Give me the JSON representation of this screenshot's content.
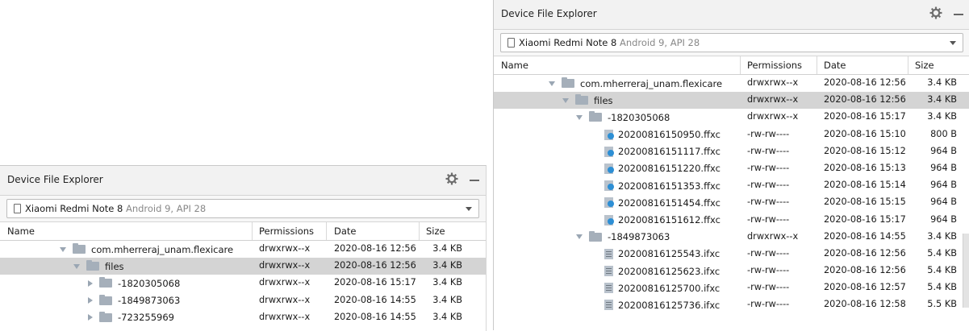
{
  "panel_a": {
    "title": "Device File Explorer",
    "device_name": "Xiaomi Redmi Note 8",
    "device_meta": "Android 9, API 28",
    "columns": {
      "name": "Name",
      "permissions": "Permissions",
      "date": "Date",
      "size": "Size"
    },
    "rows": [
      {
        "name": "com.mherreraj_unam.flexicare",
        "perm": "drwxrwx--x",
        "date": "2020-08-16 12:56",
        "size": "3.4 KB",
        "kind": "folder",
        "expanded": true,
        "depth": 0,
        "selected": false
      },
      {
        "name": "files",
        "perm": "drwxrwx--x",
        "date": "2020-08-16 12:56",
        "size": "3.4 KB",
        "kind": "folder",
        "expanded": true,
        "depth": 1,
        "selected": true
      },
      {
        "name": "-1820305068",
        "perm": "drwxrwx--x",
        "date": "2020-08-16 15:17",
        "size": "3.4 KB",
        "kind": "folder",
        "expanded": false,
        "depth": 2,
        "selected": false
      },
      {
        "name": "-1849873063",
        "perm": "drwxrwx--x",
        "date": "2020-08-16 14:55",
        "size": "3.4 KB",
        "kind": "folder",
        "expanded": false,
        "depth": 2,
        "selected": false
      },
      {
        "name": "-723255969",
        "perm": "drwxrwx--x",
        "date": "2020-08-16 14:55",
        "size": "3.4 KB",
        "kind": "folder",
        "expanded": false,
        "depth": 2,
        "selected": false
      }
    ]
  },
  "panel_b": {
    "title": "Device File Explorer",
    "device_name": "Xiaomi Redmi Note 8",
    "device_meta": "Android 9, API 28",
    "columns": {
      "name": "Name",
      "permissions": "Permissions",
      "date": "Date",
      "size": "Size"
    },
    "rows": [
      {
        "name": "com.mherreraj_unam.flexicare",
        "perm": "drwxrwx--x",
        "date": "2020-08-16 12:56",
        "size": "3.4 KB",
        "kind": "folder",
        "expanded": true,
        "depth": 0,
        "selected": false
      },
      {
        "name": "files",
        "perm": "drwxrwx--x",
        "date": "2020-08-16 12:56",
        "size": "3.4 KB",
        "kind": "folder",
        "expanded": true,
        "depth": 1,
        "selected": true
      },
      {
        "name": "-1820305068",
        "perm": "drwxrwx--x",
        "date": "2020-08-16 15:17",
        "size": "3.4 KB",
        "kind": "folder",
        "expanded": true,
        "depth": 2,
        "selected": false
      },
      {
        "name": "20200816150950.ffxc",
        "perm": "-rw-rw----",
        "date": "2020-08-16 15:10",
        "size": "800 B",
        "kind": "file-user",
        "depth": 3,
        "selected": false
      },
      {
        "name": "20200816151117.ffxc",
        "perm": "-rw-rw----",
        "date": "2020-08-16 15:12",
        "size": "964 B",
        "kind": "file-user",
        "depth": 3,
        "selected": false
      },
      {
        "name": "20200816151220.ffxc",
        "perm": "-rw-rw----",
        "date": "2020-08-16 15:13",
        "size": "964 B",
        "kind": "file-user",
        "depth": 3,
        "selected": false
      },
      {
        "name": "20200816151353.ffxc",
        "perm": "-rw-rw----",
        "date": "2020-08-16 15:14",
        "size": "964 B",
        "kind": "file-user",
        "depth": 3,
        "selected": false
      },
      {
        "name": "20200816151454.ffxc",
        "perm": "-rw-rw----",
        "date": "2020-08-16 15:15",
        "size": "964 B",
        "kind": "file-user",
        "depth": 3,
        "selected": false
      },
      {
        "name": "20200816151612.ffxc",
        "perm": "-rw-rw----",
        "date": "2020-08-16 15:17",
        "size": "964 B",
        "kind": "file-user",
        "depth": 3,
        "selected": false
      },
      {
        "name": "-1849873063",
        "perm": "drwxrwx--x",
        "date": "2020-08-16 14:55",
        "size": "3.4 KB",
        "kind": "folder",
        "expanded": true,
        "depth": 2,
        "selected": false
      },
      {
        "name": "20200816125543.ifxc",
        "perm": "-rw-rw----",
        "date": "2020-08-16 12:56",
        "size": "5.4 KB",
        "kind": "file-doc",
        "depth": 3,
        "selected": false
      },
      {
        "name": "20200816125623.ifxc",
        "perm": "-rw-rw----",
        "date": "2020-08-16 12:56",
        "size": "5.4 KB",
        "kind": "file-doc",
        "depth": 3,
        "selected": false
      },
      {
        "name": "20200816125700.ifxc",
        "perm": "-rw-rw----",
        "date": "2020-08-16 12:57",
        "size": "5.4 KB",
        "kind": "file-doc",
        "depth": 3,
        "selected": false
      },
      {
        "name": "20200816125736.ifxc",
        "perm": "-rw-rw----",
        "date": "2020-08-16 12:58",
        "size": "5.5 KB",
        "kind": "file-doc",
        "depth": 3,
        "selected": false
      }
    ]
  }
}
